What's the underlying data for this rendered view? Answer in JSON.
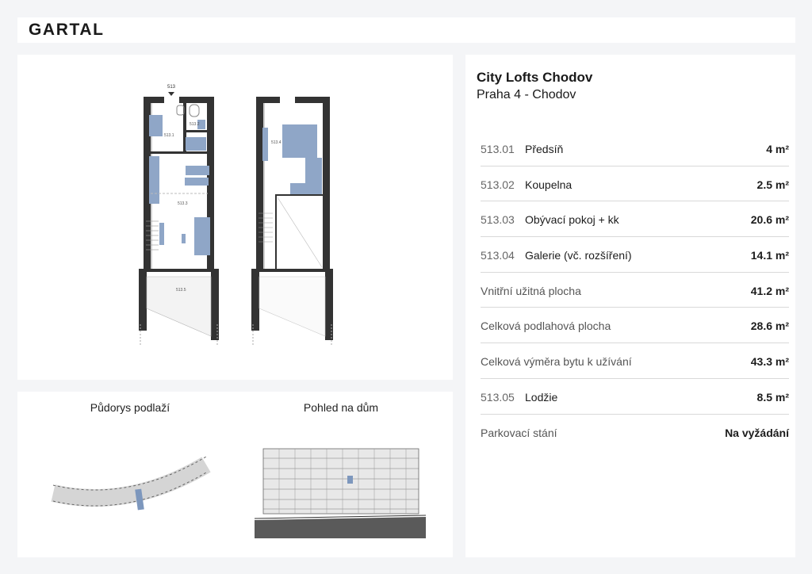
{
  "brand": {
    "logo_text": "GARTAL"
  },
  "project": {
    "name": "City Lofts Chodov",
    "location": "Praha 4 - Chodov"
  },
  "floorplan": {
    "unit_label": "513",
    "rooms": [
      "513.1",
      "513.2",
      "513.3",
      "513.4",
      "513.5"
    ],
    "accent_color": "#8fa6c7"
  },
  "thumbnails": {
    "floor_label": "Půdorys podlaží",
    "house_label": "Pohled na dům"
  },
  "areas": [
    {
      "code": "513.01",
      "name": "Předsíň",
      "value": "4 m²"
    },
    {
      "code": "513.02",
      "name": "Koupelna",
      "value": "2.5 m²"
    },
    {
      "code": "513.03",
      "name": "Obývací pokoj + kk",
      "value": "20.6 m²"
    },
    {
      "code": "513.04",
      "name": "Galerie (vč. rozšíření)",
      "value": "14.1 m²"
    },
    {
      "code": "",
      "name": "Vnitřní užitná plocha",
      "value": "41.2 m²"
    },
    {
      "code": "",
      "name": "Celková podlahová plocha",
      "value": "28.6 m²"
    },
    {
      "code": "",
      "name": "Celková výměra bytu k užívání",
      "value": "43.3 m²"
    },
    {
      "code": "513.05",
      "name": "Lodžie",
      "value": "8.5 m²"
    },
    {
      "code": "",
      "name": "Parkovací stání",
      "value": "Na vyžádání"
    }
  ]
}
